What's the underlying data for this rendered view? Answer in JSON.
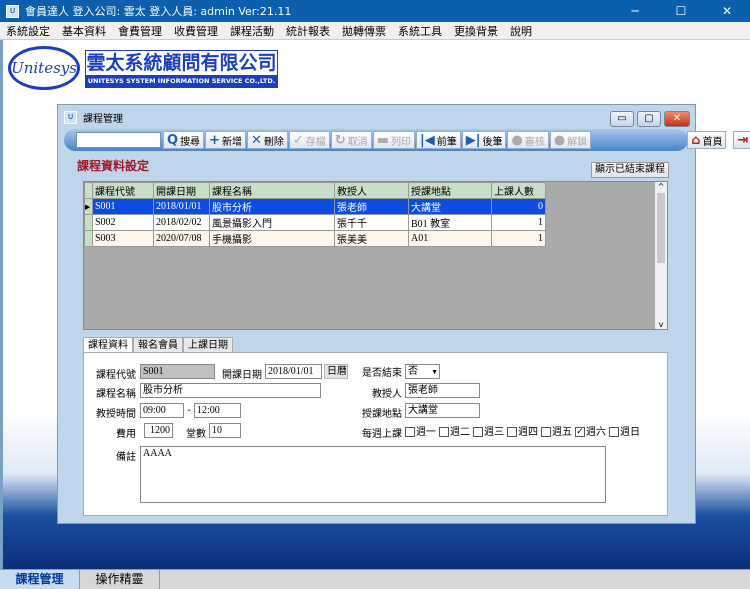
{
  "app": {
    "title": "會員達人  登入公司: 雲太  登入人員: admin Ver:21.11"
  },
  "menu": [
    "系統設定",
    "基本資料",
    "會費管理",
    "收費管理",
    "課程活動",
    "統計報表",
    "拋轉傳票",
    "系統工具",
    "更換背景",
    "說明"
  ],
  "logo": {
    "oval": "Unitesys",
    "cn": "雲太系統顧問有限公司",
    "en": "UNITESYS SYSTEM INFORMATION SERVICE CO.,LTD."
  },
  "window": {
    "title": "課程管理",
    "section_title": "課程資料設定",
    "show_ended": "顯示已結束課程"
  },
  "toolbar": {
    "search_placeholder": "",
    "search": "搜尋",
    "add": "新增",
    "delete": "刪除",
    "save": "存檔",
    "cancel": "取消",
    "print": "列印",
    "prev": "前筆",
    "next": "後筆",
    "audit": "審核",
    "unlock": "解鎖",
    "home": "首頁",
    "exit": "離開"
  },
  "grid": {
    "columns": [
      "課程代號",
      "開課日期",
      "課程名稱",
      "教授人",
      "授課地點",
      "上課人數"
    ],
    "rows": [
      [
        "S001",
        "2018/01/01",
        "股市分析",
        "張老師",
        "大講堂",
        "0"
      ],
      [
        "S002",
        "2018/02/02",
        "風景攝影入門",
        "張千千",
        "B01 教室",
        "1"
      ],
      [
        "S003",
        "2020/07/08",
        "手機攝影",
        "張美美",
        "A01",
        "1"
      ]
    ]
  },
  "tabs": [
    "課程資料",
    "報名會員",
    "上課日期"
  ],
  "form": {
    "code_label": "課程代號",
    "code": "S001",
    "start_label": "開課日期",
    "start": "2018/01/01",
    "calendar": "日曆",
    "ended_label": "是否結束",
    "ended": "否",
    "name_label": "課程名稱",
    "name": "股市分析",
    "teacher_label": "教授人",
    "teacher": "張老師",
    "time_label": "教授時間",
    "time_from": "09:00",
    "time_sep": "-",
    "time_to": "12:00",
    "place_label": "授課地點",
    "place": "大講堂",
    "fee_label": "費用",
    "fee": "1200",
    "sessions_label": "堂數",
    "sessions": "10",
    "weekly_label": "每週上課",
    "days": [
      {
        "label": "週一",
        "checked": false
      },
      {
        "label": "週二",
        "checked": false
      },
      {
        "label": "週三",
        "checked": false
      },
      {
        "label": "週四",
        "checked": false
      },
      {
        "label": "週五",
        "checked": false
      },
      {
        "label": "週六",
        "checked": true
      },
      {
        "label": "週日",
        "checked": false
      }
    ],
    "note_label": "備註",
    "note": "AAAA"
  },
  "taskbar": [
    "課程管理",
    "操作精靈"
  ]
}
